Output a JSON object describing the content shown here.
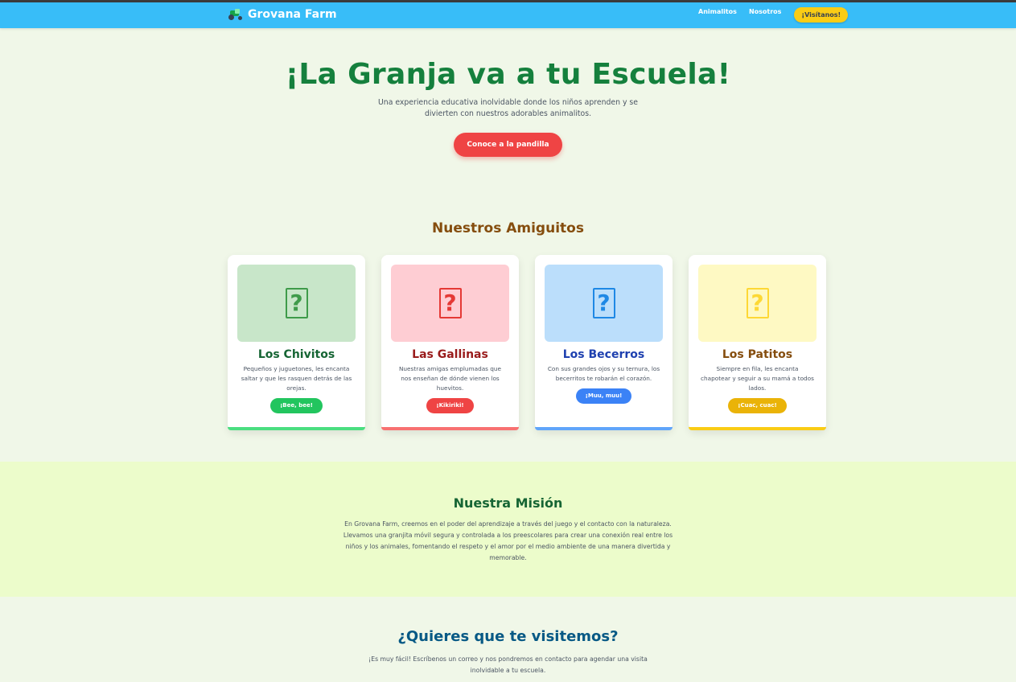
{
  "header": {
    "brand": "Grovana Farm",
    "brand_icon": "tractor-icon",
    "nav": [
      {
        "label": "Animalitos"
      },
      {
        "label": "Nosotros"
      }
    ],
    "cta": "¡Visítanos!"
  },
  "hero": {
    "title": "¡La Granja va a tu Escuela!",
    "subtitle": "Una experiencia educativa inolvidable donde los niños aprenden y se divierten con nuestros adorables animalitos.",
    "button": "Conoce a la pandilla"
  },
  "friends": {
    "title": "Nuestros Amiguitos",
    "cards": [
      {
        "name": "Los Chivitos",
        "desc": "Pequeños y juguetones, les encanta saltar y que les rasquen detrás de las orejas.",
        "sound": "¡Bee, bee!",
        "glyph": "?",
        "icon": "missing-glyph-icon",
        "accent": "#22c55e",
        "img_bg": "#c8e6c9",
        "title_color": "#166534",
        "glyph_color": "#3f9b4a",
        "bar_color": "#4ade80"
      },
      {
        "name": "Las Gallinas",
        "desc": "Nuestras amigas emplumadas que nos enseñan de dónde vienen los huevitos.",
        "sound": "¡Kikiriki!",
        "glyph": "?",
        "icon": "missing-glyph-icon",
        "accent": "#ef4444",
        "img_bg": "#fecdd3",
        "title_color": "#991b1b",
        "glyph_color": "#e53935",
        "bar_color": "#f87171"
      },
      {
        "name": "Los Becerros",
        "desc": "Con sus grandes ojos y su ternura, los becerritos te robarán el corazón.",
        "sound": "¡Muu, muu!",
        "glyph": "?",
        "icon": "missing-glyph-icon",
        "accent": "#3b82f6",
        "img_bg": "#bbdefb",
        "title_color": "#1e40af",
        "glyph_color": "#1e88e5",
        "bar_color": "#60a5fa"
      },
      {
        "name": "Los Patitos",
        "desc": "Siempre en fila, les encanta chapotear y seguir a su mamá a todos lados.",
        "sound": "¡Cuac, cuac!",
        "glyph": "?",
        "icon": "missing-glyph-icon",
        "accent": "#eab308",
        "img_bg": "#fef9c3",
        "title_color": "#854d0e",
        "glyph_color": "#fdd835",
        "bar_color": "#facc15"
      }
    ]
  },
  "mission": {
    "title": "Nuestra Misión",
    "text": "En Grovana Farm, creemos en el poder del aprendizaje a través del juego y el contacto con la naturaleza. Llevamos una granjita móvil segura y controlada a los preescolares para crear una conexión real entre los niños y los animales, fomentando el respeto y el amor por el medio ambiente de una manera divertida y memorable."
  },
  "contact": {
    "title": "¿Quieres que te visitemos?",
    "text": "¡Es muy fácil! Escríbenos un correo y nos pondremos en contacto para agendar una visita inolvidable a tu escuela."
  }
}
